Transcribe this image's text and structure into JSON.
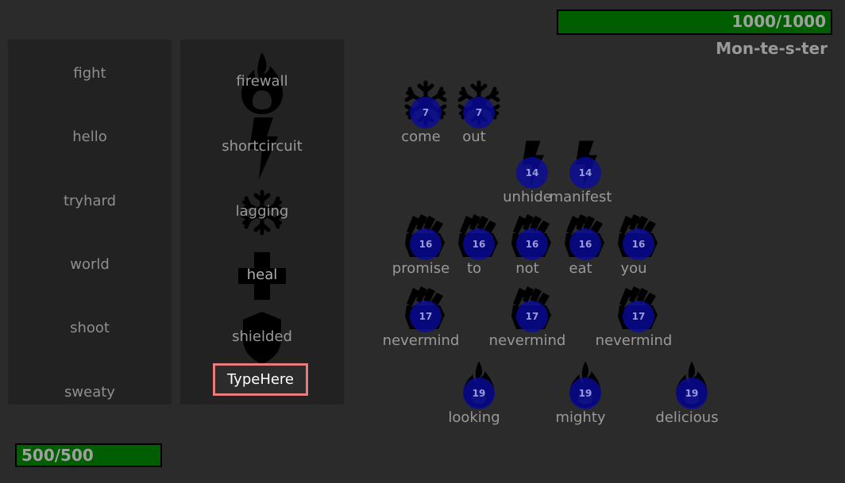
{
  "enemy": {
    "name": "Mon-te-s-ter",
    "hp_text": "1000/1000",
    "hp_fraction": 1.0
  },
  "player": {
    "hp_text": "500/500",
    "hp_fraction": 1.0
  },
  "words": [
    "fight",
    "hello",
    "tryhard",
    "world",
    "shoot",
    "sweaty"
  ],
  "spells": [
    {
      "label": "firewall",
      "icon": "fire-icon"
    },
    {
      "label": "shortcircuit",
      "icon": "lightning-icon"
    },
    {
      "label": "lagging",
      "icon": "snowflake-icon"
    },
    {
      "label": "heal",
      "icon": "cross-icon"
    },
    {
      "label": "shielded",
      "icon": "shield-icon"
    }
  ],
  "input": {
    "value": "TypeHere"
  },
  "attacks": [
    {
      "word": "come",
      "timer": "7",
      "icon": "snowflake-icon"
    },
    {
      "word": "out",
      "timer": "7",
      "icon": "snowflake-icon"
    },
    {
      "word": "unhide",
      "timer": "14",
      "icon": "lightning-icon"
    },
    {
      "word": "manifest",
      "timer": "14",
      "icon": "lightning-icon"
    },
    {
      "word": "promise",
      "timer": "16",
      "icon": "fist-icon"
    },
    {
      "word": "to",
      "timer": "16",
      "icon": "fist-icon"
    },
    {
      "word": "not",
      "timer": "16",
      "icon": "fist-icon"
    },
    {
      "word": "eat",
      "timer": "16",
      "icon": "fist-icon"
    },
    {
      "word": "you",
      "timer": "16",
      "icon": "fist-icon"
    },
    {
      "word": "nevermind",
      "timer": "17",
      "icon": "fist-icon"
    },
    {
      "word": "nevermind",
      "timer": "17",
      "icon": "fist-icon"
    },
    {
      "word": "nevermind",
      "timer": "17",
      "icon": "fist-icon"
    },
    {
      "word": "looking",
      "timer": "19",
      "icon": "fire-icon"
    },
    {
      "word": "mighty",
      "timer": "19",
      "icon": "fire-icon"
    },
    {
      "word": "delicious",
      "timer": "19",
      "icon": "fire-icon"
    }
  ],
  "colors": {
    "hp_fill": "#005e00",
    "input_border": "#e87b7b",
    "timer": "#0a0aa0"
  }
}
